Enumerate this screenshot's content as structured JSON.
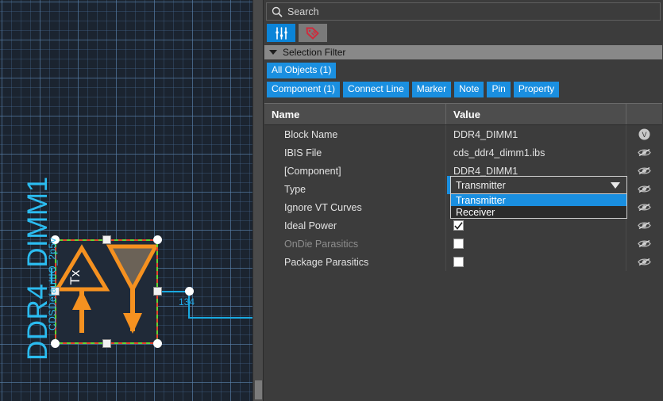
{
  "canvas": {
    "instance_label": "DDR4_DIMM1",
    "pin_label": "CDSDefaultIO_2p5v",
    "symbol_text": "Tx",
    "net_label": "134",
    "grid_color": "#1b2430",
    "net_color": "#19a9e0",
    "symbol_color": "#f59120",
    "selection_colors": [
      "#e8452c",
      "#62d432"
    ]
  },
  "panel": {
    "search": {
      "placeholder": "Search",
      "value": "",
      "icon": "search-icon"
    },
    "toolbar": {
      "buttons": [
        {
          "name": "filter-sliders-icon",
          "label": "",
          "active": true,
          "accent": "#0b84d8"
        },
        {
          "name": "tag-icon",
          "label": "",
          "active": false,
          "accent": "#cf2b3c"
        }
      ]
    },
    "section": {
      "title": "Selection Filter",
      "expanded": true,
      "caret": "chevron-down-icon"
    },
    "filters": {
      "primary": [
        {
          "label": "All Objects (1)",
          "name": "filter-all-objects"
        }
      ],
      "secondary": [
        {
          "label": "Component (1)",
          "name": "filter-component"
        },
        {
          "label": "Connect Line",
          "name": "filter-connect-line"
        },
        {
          "label": "Marker",
          "name": "filter-marker"
        },
        {
          "label": "Note",
          "name": "filter-note"
        },
        {
          "label": "Pin",
          "name": "filter-pin"
        },
        {
          "label": "Property",
          "name": "filter-property"
        }
      ],
      "chip_color": "#1a8fe0"
    },
    "table": {
      "headers": {
        "name": "Name",
        "value": "Value",
        "icon": ""
      },
      "rows": [
        {
          "name": "Block Name",
          "value": "DDR4_DIMM1",
          "kind": "text",
          "icon": "v-badge-icon",
          "dim": false
        },
        {
          "name": "IBIS File",
          "value": "cds_ddr4_dimm1.ibs",
          "kind": "text",
          "icon": "eye-slash-icon",
          "dim": false
        },
        {
          "name": "[Component]",
          "value": "DDR4_DIMM1",
          "kind": "text",
          "icon": "eye-slash-icon",
          "dim": false
        },
        {
          "name": "Type",
          "value": "Transmitter",
          "kind": "combo",
          "icon": "eye-slash-icon",
          "dim": false
        },
        {
          "name": "Ignore VT Curves",
          "value": "",
          "kind": "hidden",
          "icon": "eye-slash-icon",
          "dim": false
        },
        {
          "name": "Ideal Power",
          "value": "checked",
          "kind": "checkbox",
          "icon": "eye-slash-icon",
          "dim": false
        },
        {
          "name": "OnDie Parasitics",
          "value": "unchecked",
          "kind": "checkbox",
          "icon": "eye-slash-icon",
          "dim": true
        },
        {
          "name": "Package Parasitics",
          "value": "unchecked",
          "kind": "checkbox",
          "icon": "eye-slash-icon",
          "dim": false
        }
      ]
    },
    "combo": {
      "value": "Transmitter",
      "open": true,
      "options": [
        {
          "label": "Transmitter",
          "selected": true
        },
        {
          "label": "Receiver",
          "selected": false
        }
      ],
      "highlight_color": "#1a8fe0"
    }
  }
}
